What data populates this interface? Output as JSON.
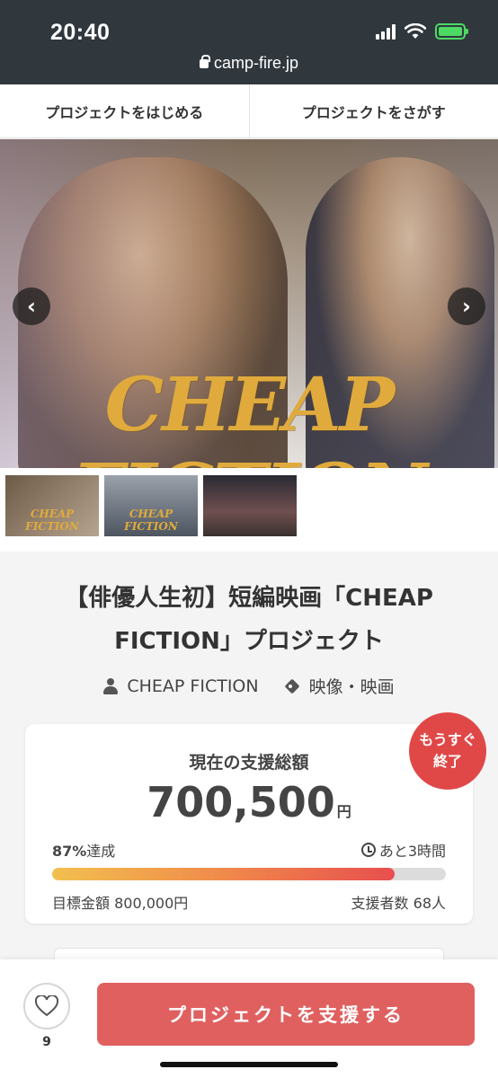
{
  "status_bar": {
    "time": "20:40",
    "url": "camp-fire.jp",
    "battery_color": "#4cd964"
  },
  "nav": {
    "start_label": "プロジェクトをはじめる",
    "search_label": "プロジェクトをさがす"
  },
  "hero": {
    "title_art": "CHEAP FICTION",
    "prev_icon": "chevron-left-icon",
    "next_icon": "chevron-right-icon"
  },
  "thumbnails": [
    {
      "label": "CHEAP FICTION"
    },
    {
      "label": "CHEAP FICTION"
    },
    {
      "label": ""
    }
  ],
  "project": {
    "title": "【俳優人生初】短編映画「CHEAP FICTION」プロジェクト",
    "owner": "CHEAP FICTION",
    "category": "映像・映画"
  },
  "funding": {
    "label": "現在の支援総額",
    "amount": "700,500",
    "currency": "円",
    "percent_text": "87%",
    "percent_suffix": "達成",
    "progress_fraction": 0.87,
    "remaining": "あと3時間",
    "goal": "目標金額 800,000円",
    "backers": "支援者数 68人",
    "badge_line1": "もうすぐ",
    "badge_line2": "終了",
    "badge_color": "#e04848"
  },
  "footer": {
    "like_count": "9",
    "support_label": "プロジェクトを支援する",
    "support_color": "#e06060"
  }
}
